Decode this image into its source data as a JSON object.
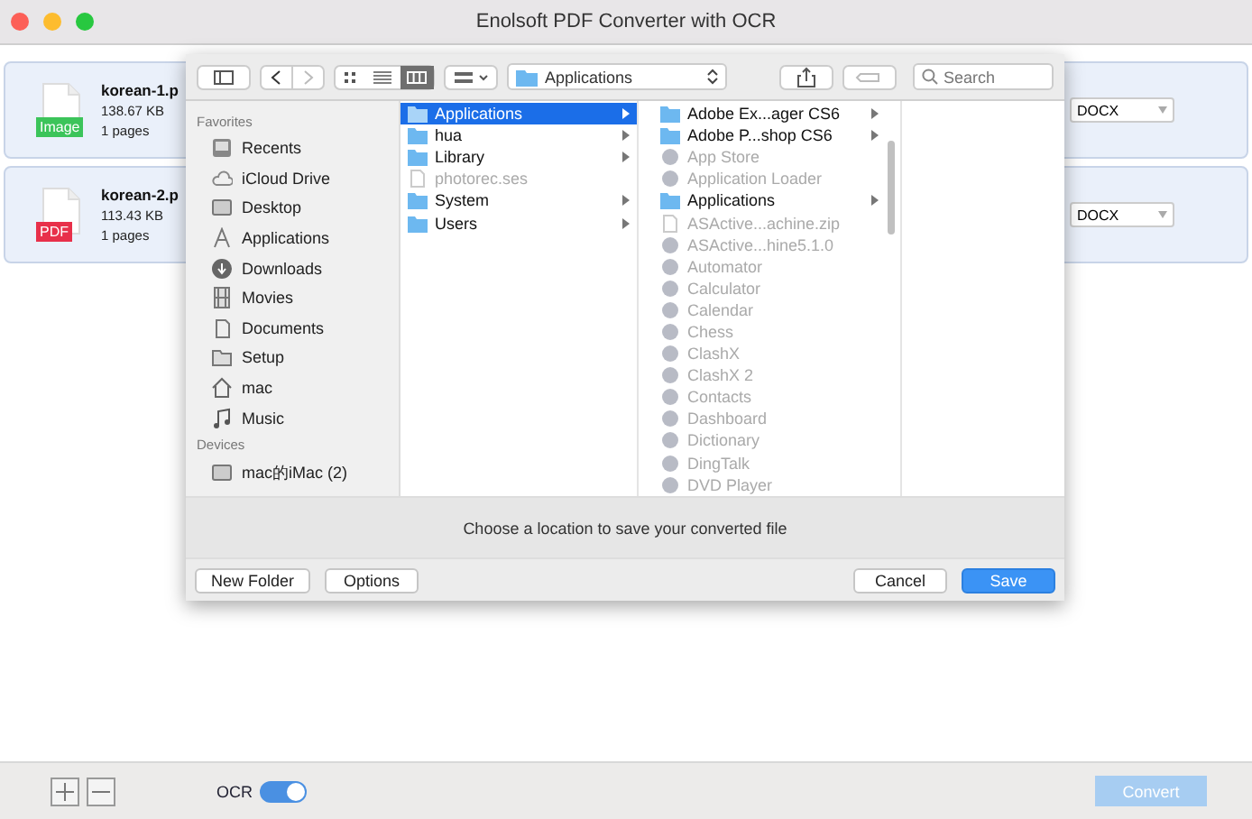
{
  "window": {
    "title": "Enolsoft PDF Converter with OCR"
  },
  "files": [
    {
      "name": "korean-1.p",
      "size": "138.67 KB",
      "pages": "1 pages",
      "badge": "Image",
      "color": "#3cc45a",
      "format": "DOCX"
    },
    {
      "name": "korean-2.p",
      "size": "113.43 KB",
      "pages": "1 pages",
      "badge": "PDF",
      "color": "#e8304a",
      "format": "DOCX"
    }
  ],
  "dialog": {
    "location": "Applications",
    "search": {
      "placeholder": "Search"
    },
    "sidebar": [
      {
        "heading": "Favorites",
        "items": [
          {
            "label": "Recents",
            "kind": "recents"
          },
          {
            "label": "iCloud Drive",
            "kind": "cloud"
          },
          {
            "label": "Desktop",
            "kind": "desktop"
          },
          {
            "label": "Applications",
            "kind": "apps"
          },
          {
            "label": "Downloads",
            "kind": "downloads"
          },
          {
            "label": "Movies",
            "kind": "movies"
          },
          {
            "label": "Documents",
            "kind": "documents"
          },
          {
            "label": "Setup",
            "kind": "folder"
          },
          {
            "label": "mac",
            "kind": "home"
          },
          {
            "label": "Music",
            "kind": "music"
          }
        ]
      },
      {
        "heading": "Devices",
        "items": [
          {
            "label": "mac的iMac (2)",
            "kind": "computer"
          }
        ]
      }
    ],
    "columns": [
      [
        {
          "label": "Applications",
          "kind": "folder",
          "selected": true,
          "disabled": false,
          "expandable": true
        },
        {
          "label": "hua",
          "kind": "folder",
          "selected": false,
          "disabled": false,
          "expandable": true
        },
        {
          "label": "Library",
          "kind": "folder",
          "selected": false,
          "disabled": false,
          "expandable": true
        },
        {
          "label": "photorec.ses",
          "kind": "file",
          "selected": false,
          "disabled": true,
          "expandable": false
        },
        {
          "label": "System",
          "kind": "folder",
          "selected": false,
          "disabled": false,
          "expandable": true
        },
        {
          "label": "Users",
          "kind": "folder",
          "selected": false,
          "disabled": false,
          "expandable": true
        }
      ],
      [
        {
          "label": "Adobe Ex...ager CS6",
          "kind": "folder",
          "selected": false,
          "disabled": false,
          "expandable": true
        },
        {
          "label": "Adobe P...shop CS6",
          "kind": "folder",
          "selected": false,
          "disabled": false,
          "expandable": true
        },
        {
          "label": "App Store",
          "kind": "app",
          "selected": false,
          "disabled": true,
          "expandable": false
        },
        {
          "label": "Application Loader",
          "kind": "app",
          "selected": false,
          "disabled": true,
          "expandable": false
        },
        {
          "label": "Applications",
          "kind": "folder",
          "selected": false,
          "disabled": false,
          "expandable": true
        },
        {
          "label": "ASActive...achine.zip",
          "kind": "file",
          "selected": false,
          "disabled": true,
          "expandable": false
        },
        {
          "label": "ASActive...hine5.1.0",
          "kind": "app",
          "selected": false,
          "disabled": true,
          "expandable": false
        },
        {
          "label": "Automator",
          "kind": "app",
          "selected": false,
          "disabled": true,
          "expandable": false
        },
        {
          "label": "Calculator",
          "kind": "app",
          "selected": false,
          "disabled": true,
          "expandable": false
        },
        {
          "label": "Calendar",
          "kind": "app",
          "selected": false,
          "disabled": true,
          "expandable": false
        },
        {
          "label": "Chess",
          "kind": "app",
          "selected": false,
          "disabled": true,
          "expandable": false
        },
        {
          "label": "ClashX",
          "kind": "app",
          "selected": false,
          "disabled": true,
          "expandable": false
        },
        {
          "label": "ClashX 2",
          "kind": "app",
          "selected": false,
          "disabled": true,
          "expandable": false
        },
        {
          "label": "Contacts",
          "kind": "app",
          "selected": false,
          "disabled": true,
          "expandable": false
        },
        {
          "label": "Dashboard",
          "kind": "app",
          "selected": false,
          "disabled": true,
          "expandable": false
        },
        {
          "label": "Dictionary",
          "kind": "app",
          "selected": false,
          "disabled": true,
          "expandable": false
        },
        {
          "label": "DingTalk",
          "kind": "app",
          "selected": false,
          "disabled": true,
          "expandable": false
        },
        {
          "label": "DVD Player",
          "kind": "app",
          "selected": false,
          "disabled": true,
          "expandable": false
        }
      ]
    ],
    "message": "Choose a location to save your converted file",
    "buttons": [
      {
        "label": "New Folder",
        "kind": "normal"
      },
      {
        "label": "Options",
        "kind": "normal"
      },
      {
        "label": "Cancel",
        "kind": "normal"
      },
      {
        "label": "Save",
        "kind": "default"
      }
    ]
  },
  "bottom": {
    "ocr": {
      "label": "OCR",
      "on": true
    },
    "convert": {
      "label": "Convert",
      "disabled": true
    }
  }
}
